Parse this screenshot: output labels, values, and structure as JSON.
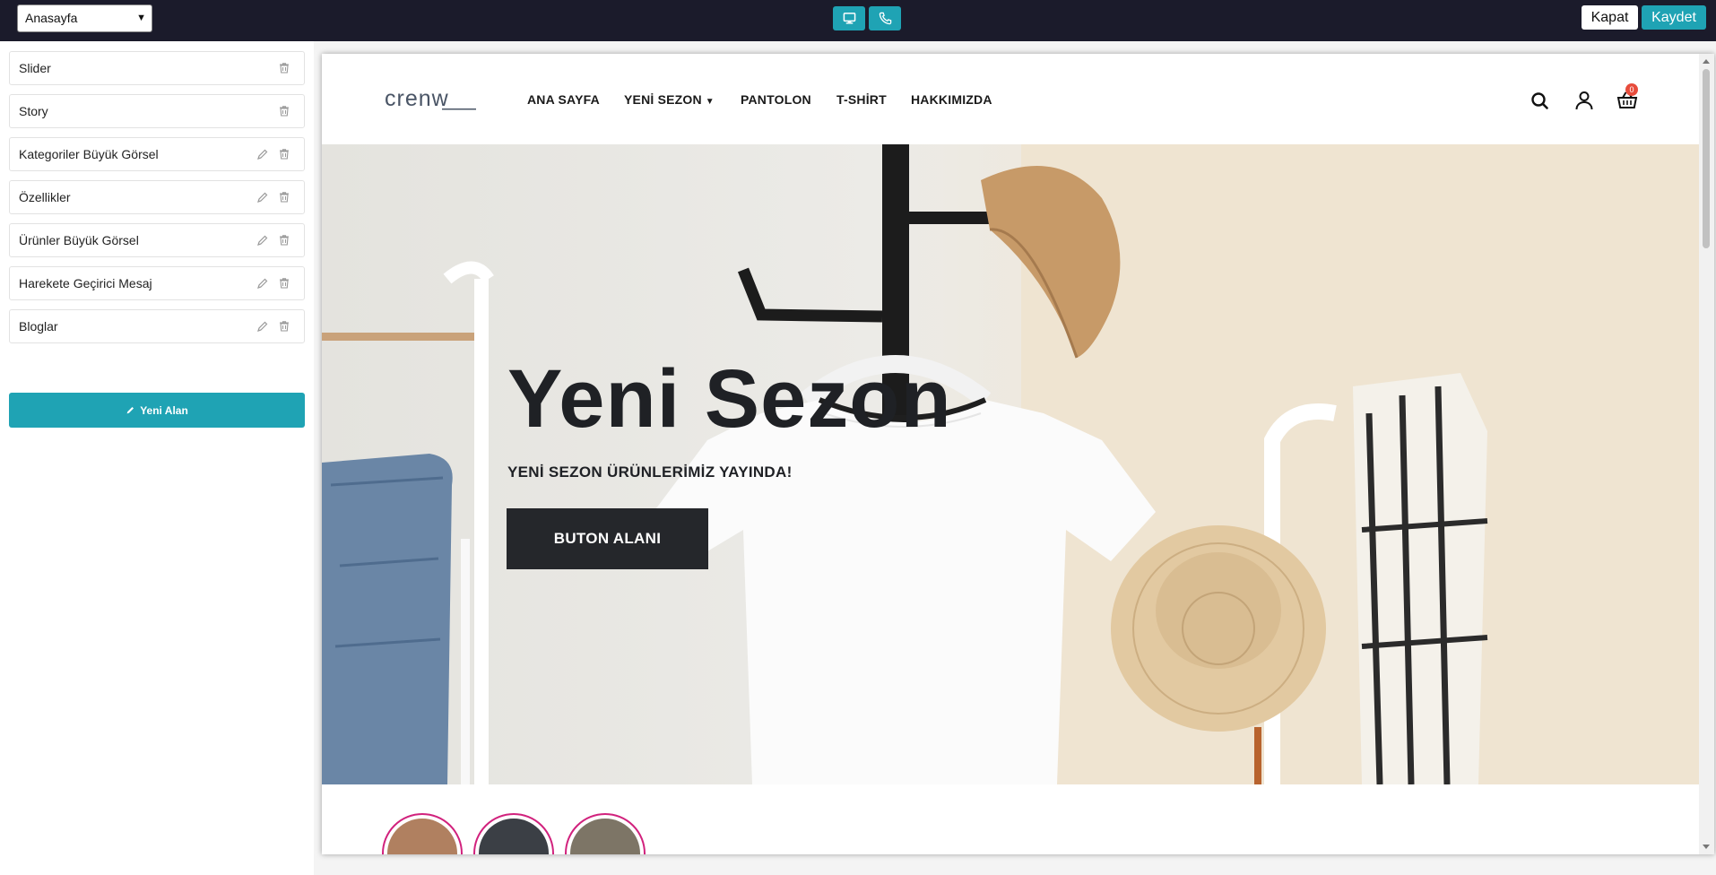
{
  "toolbar": {
    "page_select": {
      "value": "Anasayfa",
      "icon": "chevron-down-icon"
    },
    "device_buttons": [
      {
        "name": "desktop",
        "icon": "monitor-icon"
      },
      {
        "name": "mobile",
        "icon": "phone-icon"
      }
    ],
    "close_label": "Kapat",
    "save_label": "Kaydet"
  },
  "sidebar": {
    "sections": [
      {
        "label": "Slider",
        "editable": false
      },
      {
        "label": "Story",
        "editable": false
      },
      {
        "label": "Kategoriler Büyük Görsel",
        "editable": true
      },
      {
        "label": "Özellikler",
        "editable": true
      },
      {
        "label": "Ürünler Büyük Görsel",
        "editable": true
      },
      {
        "label": "Harekete Geçirici Mesaj",
        "editable": true
      },
      {
        "label": "Bloglar",
        "editable": true
      }
    ],
    "new_area_label": "Yeni Alan"
  },
  "preview": {
    "logo": "crenw",
    "nav": [
      {
        "label": "ANA SAYFA"
      },
      {
        "label": "YENİ SEZON",
        "has_dropdown": true
      },
      {
        "label": "PANTOLON"
      },
      {
        "label": "T-SHİRT"
      },
      {
        "label": "HAKKIMIZDA"
      }
    ],
    "cart_count": "0",
    "hero": {
      "title": "Yeni Sezon",
      "subtitle": "YENİ SEZON ÜRÜNLERİMİZ YAYINDA!",
      "button_label": "BUTON ALANI"
    }
  },
  "colors": {
    "topbar": "#1b1b2b",
    "accent": "#1fa3b4",
    "story_ring": "#d1227d",
    "badge": "#e74c3c"
  }
}
